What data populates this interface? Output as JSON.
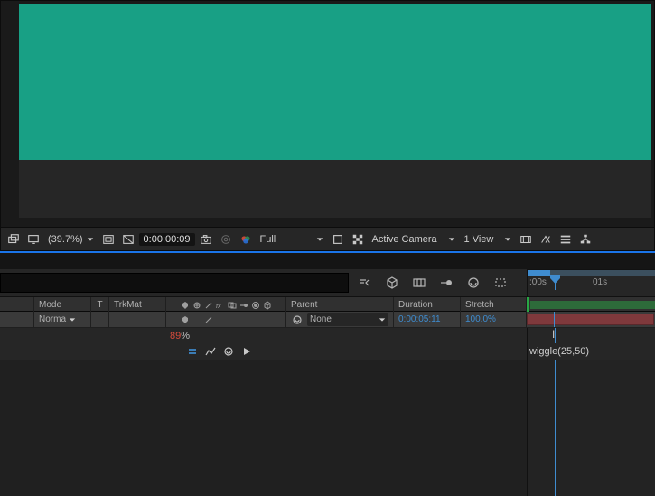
{
  "preview": {
    "zoom_label": "(39.7%)",
    "timecode": "0:00:00:09",
    "resolution": "Full",
    "camera": "Active Camera",
    "view": "1 View"
  },
  "ruler": {
    "t0": ":00s",
    "t1": "01s"
  },
  "columns": {
    "mode": "Mode",
    "t": "T",
    "trkmat": "TrkMat",
    "parent": "Parent",
    "duration": "Duration",
    "stretch": "Stretch"
  },
  "layer": {
    "mode_value": "Norma",
    "parent_value": "None",
    "duration": "0:00:05:11",
    "stretch": "100.0%"
  },
  "prop": {
    "pct_value": "89",
    "pct_suffix": "%"
  },
  "expression": {
    "text": "wiggle(25,50)"
  },
  "icon_names": {
    "magnify": "magnify-icon",
    "monitor": "monitor-icon",
    "roi": "region-of-interest-icon",
    "transparency": "transparency-grid-icon",
    "snapshot": "snapshot-icon",
    "channels": "channels-icon",
    "colormgmt": "color-management-icon",
    "grid": "grid-icon",
    "guides": "guides-icon",
    "mask": "mask-icon",
    "fast": "fast-previews-icon",
    "flowchart": "flowchart-icon",
    "exposure": "exposure-icon"
  }
}
